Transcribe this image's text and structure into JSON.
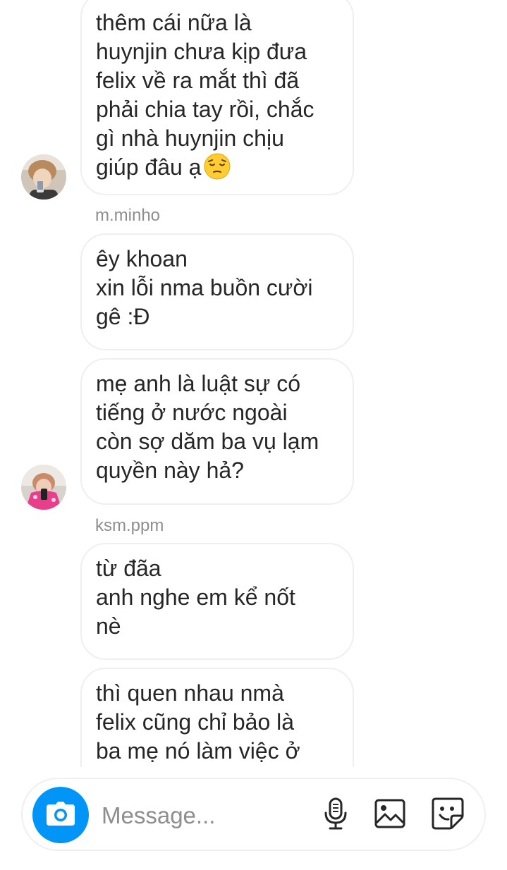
{
  "thread": {
    "messages": [
      {
        "lines": [
          "thêm cái nữa là",
          "huynjin chưa kịp đưa",
          "felix về ra mắt thì đã",
          "phải chia tay rồi, chắc",
          "gì nhà huynjin chịu",
          "giúp đâu ạ"
        ],
        "trailing_emoji": "pensive-face-emoji"
      },
      {
        "lines": [
          "êy khoan",
          "xin lỗi nma buồn cười",
          "gê :Đ"
        ]
      },
      {
        "lines": [
          "mẹ anh là luật sự có",
          "tiếng ở nước ngoài",
          "còn sợ dăm ba vụ lạm",
          "quyền này hả?"
        ]
      },
      {
        "lines": [
          "từ đãa",
          "anh nghe em kể nốt",
          "nè"
        ]
      },
      {
        "lines": [
          "thì quen nhau nmà",
          "felix cũng chỉ bảo là",
          "ba mẹ nó làm việc ở"
        ]
      }
    ],
    "senders": {
      "first": "m.minho",
      "second": "ksm.ppm"
    }
  },
  "composer": {
    "placeholder": "Message...",
    "value": "",
    "icons": [
      "camera-icon",
      "microphone-icon",
      "gallery-icon",
      "sticker-icon"
    ],
    "camera_color": "#0095f6"
  }
}
